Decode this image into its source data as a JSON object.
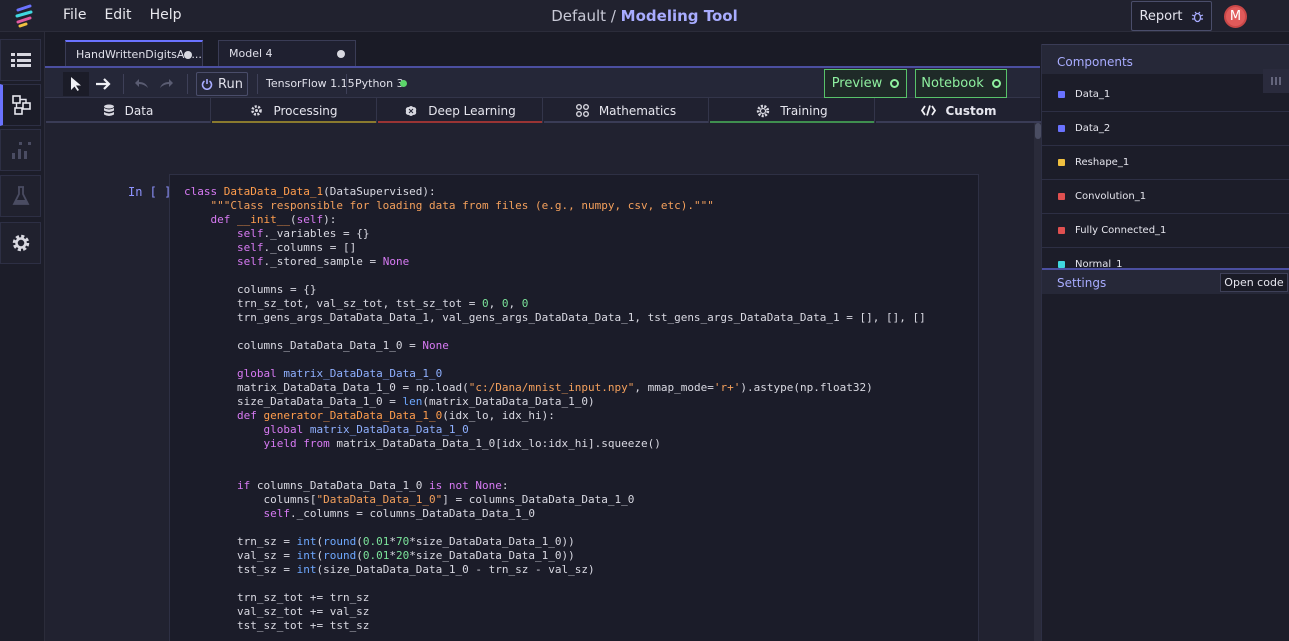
{
  "menu": {
    "file": "File",
    "edit": "Edit",
    "help": "Help"
  },
  "title": {
    "prefix": "Default /",
    "name": "Modeling Tool"
  },
  "report_label": "Report",
  "avatar_initial": "M",
  "tabs": [
    {
      "label": "HandWrittenDigitsAu..."
    },
    {
      "label": "Model 4"
    }
  ],
  "toolbar": {
    "run_label": "Run",
    "framework": "TensorFlow 1.15",
    "python": "Python 3",
    "preview_label": "Preview",
    "notebook_label": "Notebook"
  },
  "categories": [
    {
      "label": "Data",
      "color": "#3a3c56"
    },
    {
      "label": "Processing",
      "color": "#8a7a2e"
    },
    {
      "label": "Deep Learning",
      "color": "#9a3434"
    },
    {
      "label": "Mathematics",
      "color": "#3a3c56"
    },
    {
      "label": "Training",
      "color": "#3f8f4f"
    },
    {
      "label": "Custom",
      "color": "#3a3c56"
    }
  ],
  "cell_label": "In [ ]:",
  "components": {
    "header": "Components",
    "items": [
      {
        "label": "Data_1",
        "color": "#6a72ff"
      },
      {
        "label": "Data_2",
        "color": "#6a72ff"
      },
      {
        "label": "Reshape_1",
        "color": "#f0c040"
      },
      {
        "label": "Convolution_1",
        "color": "#e05050"
      },
      {
        "label": "Fully Connected_1",
        "color": "#e05050"
      },
      {
        "label": "Normal_1",
        "color": "#40d8e0"
      }
    ]
  },
  "settings": {
    "label": "Settings",
    "open_code": "Open code"
  },
  "code_lines": [
    "class DataData_Data_1(DataSupervised):",
    "    \"\"\"Class responsible for loading data from files (e.g., numpy, csv, etc).\"\"\"",
    "    def __init__(self):",
    "        self._variables = {}",
    "        self._columns = []",
    "        self._stored_sample = None",
    "",
    "        columns = {}",
    "        trn_sz_tot, val_sz_tot, tst_sz_tot = 0, 0, 0",
    "        trn_gens_args_DataData_Data_1, val_gens_args_DataData_Data_1, tst_gens_args_DataData_Data_1 = [], [], []",
    "",
    "        columns_DataData_Data_1_0 = None",
    "",
    "        global matrix_DataData_Data_1_0",
    "        matrix_DataData_Data_1_0 = np.load(\"c:/Dana/mnist_input.npy\", mmap_mode='r+').astype(np.float32)",
    "        size_DataData_Data_1_0 = len(matrix_DataData_Data_1_0)",
    "        def generator_DataData_Data_1_0(idx_lo, idx_hi):",
    "            global matrix_DataData_Data_1_0",
    "            yield from matrix_DataData_Data_1_0[idx_lo:idx_hi].squeeze()",
    "",
    "",
    "        if columns_DataData_Data_1_0 is not None:",
    "            columns[\"DataData_Data_1_0\"] = columns_DataData_Data_1_0",
    "            self._columns = columns_DataData_Data_1_0",
    "",
    "        trn_sz = int(round(0.01*70*size_DataData_Data_1_0))",
    "        val_sz = int(round(0.01*20*size_DataData_Data_1_0))",
    "        tst_sz = int(size_DataData_Data_1_0 - trn_sz - val_sz)",
    "",
    "        trn_sz_tot += trn_sz",
    "        val_sz_tot += val_sz",
    "        tst_sz_tot += tst_sz"
  ]
}
